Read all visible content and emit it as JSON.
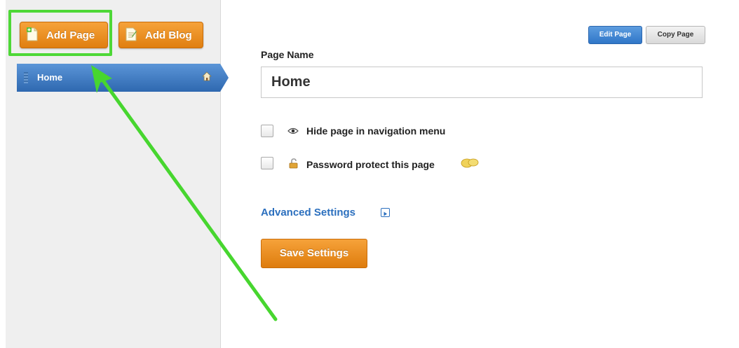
{
  "sidebar": {
    "add_page_label": "Add Page",
    "add_blog_label": "Add Blog",
    "pages": [
      {
        "label": "Home"
      }
    ]
  },
  "toolbar": {
    "edit_page_label": "Edit Page",
    "copy_page_label": "Copy Page"
  },
  "settings": {
    "page_name_label": "Page Name",
    "page_name_value": "Home",
    "hide_in_nav_label": "Hide page in navigation menu",
    "password_protect_label": "Password protect this page",
    "advanced_settings_label": "Advanced Settings",
    "save_label": "Save Settings"
  },
  "colors": {
    "accent_orange": "#e88a1a",
    "nav_blue": "#3b7bc8",
    "highlight_green": "#4ed837",
    "link_blue": "#2b6fbe"
  }
}
